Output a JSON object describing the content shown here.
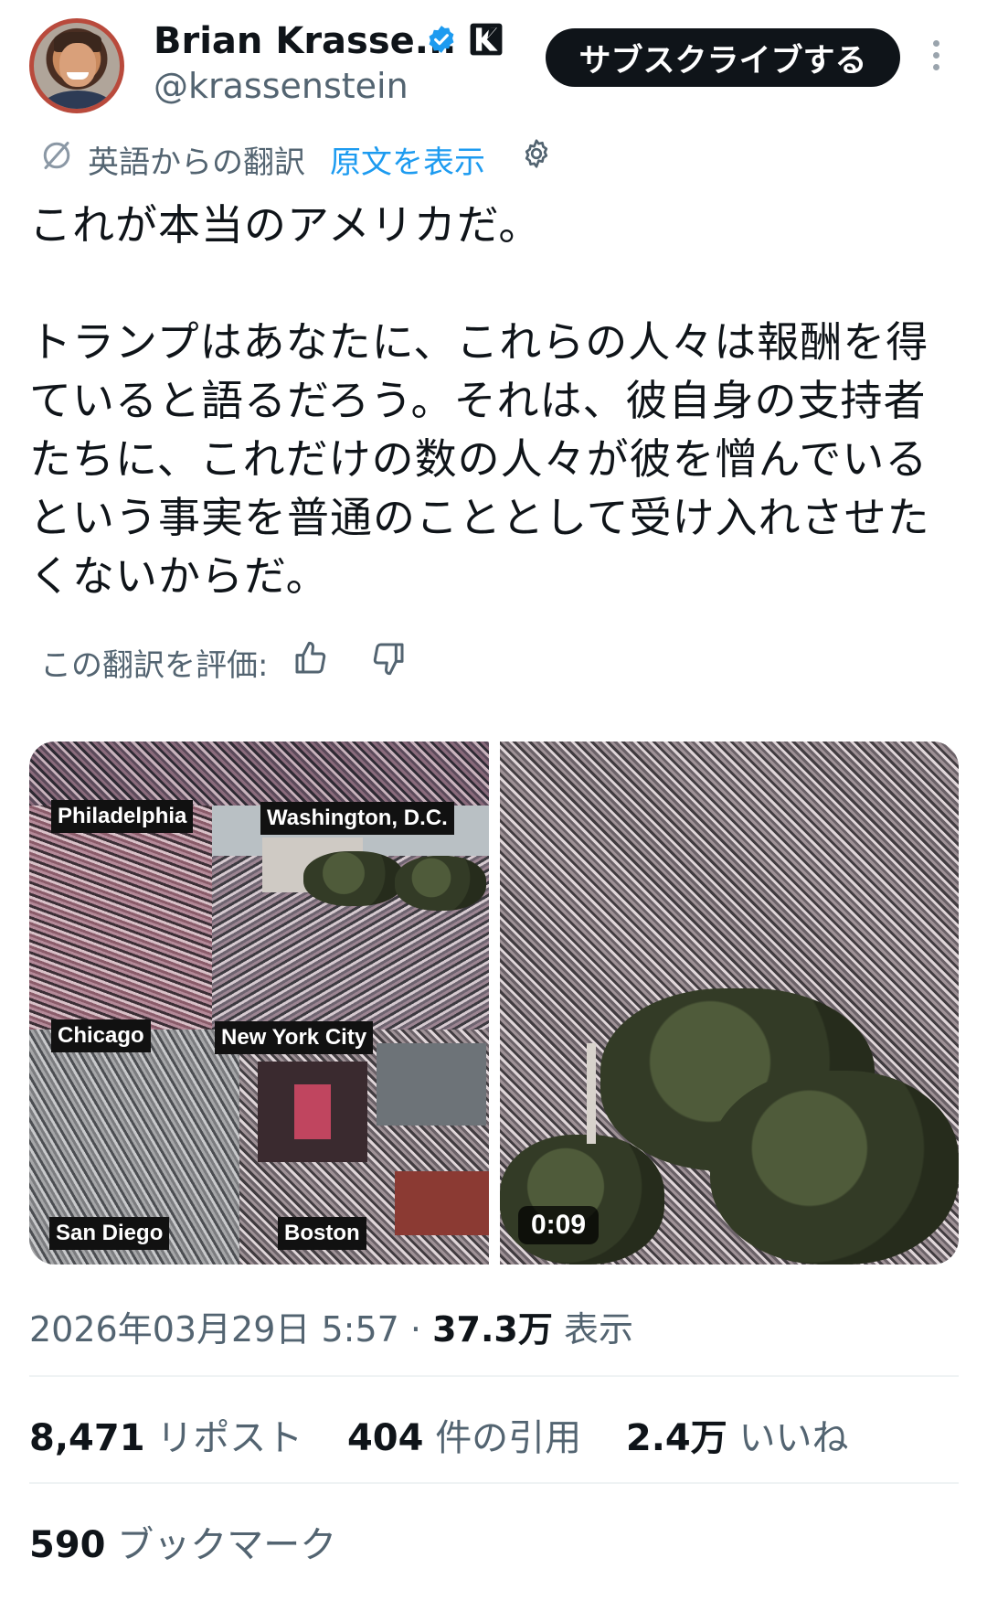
{
  "header": {
    "display_name": "Brian Krasse...",
    "handle": "@krassenstein",
    "subscribe_label": "サブスクライブする",
    "verified_icon": "verified-badge-icon",
    "brand_icon": "k-logo-icon",
    "more_icon": "more-vertical-icon",
    "accent_color": "#1d9bf0"
  },
  "translation": {
    "label": "英語からの翻訳",
    "show_original": "原文を表示",
    "rate_label": "この翻訳を評価:"
  },
  "tweet": {
    "line1": "これが本当のアメリカだ。",
    "paragraph2": "トランプはあなたに、これらの人々は報酬を得ていると語るだろう。それは、彼自身の支持者たちに、これだけの数の人々が彼を憎んでいるという事実を普通のこととして受け入れさせたくないからだ。"
  },
  "media": {
    "labels": [
      "Philadelphia",
      "Washington, D.C.",
      "Chicago",
      "New York City",
      "San Diego",
      "Boston"
    ],
    "duration": "0:09"
  },
  "meta": {
    "timestamp": "2026年03月29日 5:57",
    "separator": "·",
    "views_count": "37.3万",
    "views_label": "表示"
  },
  "stats": {
    "reposts_count": "8,471",
    "reposts_label": "リポスト",
    "quotes_count": "404",
    "quotes_label": "件の引用",
    "likes_count": "2.4万",
    "likes_label": "いいね",
    "bookmarks_count": "590",
    "bookmarks_label": "ブックマーク"
  }
}
